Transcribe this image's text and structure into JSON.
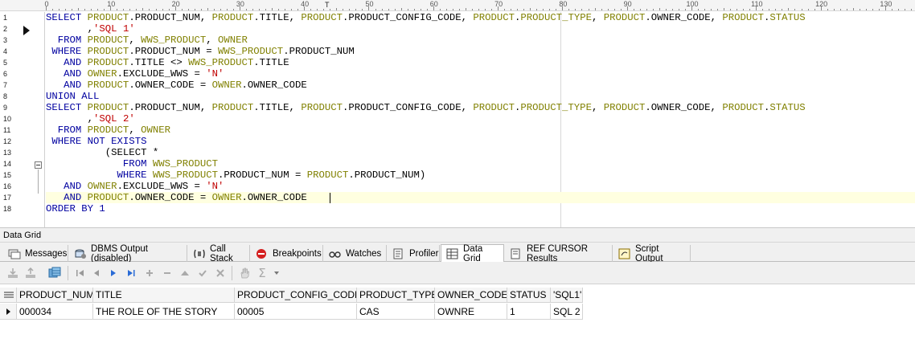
{
  "editor": {
    "ruler_labels": [
      "0",
      "10",
      "20",
      "30",
      "40",
      "50",
      "60",
      "70",
      "80",
      "90",
      "100",
      "110",
      "120",
      "130"
    ],
    "line_numbers": [
      "1",
      "2",
      "3",
      "4",
      "5",
      "6",
      "7",
      "8",
      "9",
      "10",
      "11",
      "12",
      "13",
      "14",
      "15",
      "16",
      "17",
      "18"
    ],
    "lines": [
      [
        [
          "kw",
          "SELECT "
        ],
        [
          "ob",
          "PRODUCT"
        ],
        [
          "sym",
          "."
        ],
        [
          "sym",
          "PRODUCT_NUM"
        ],
        [
          "sym",
          ", "
        ],
        [
          "ob",
          "PRODUCT"
        ],
        [
          "sym",
          ".TITLE, "
        ],
        [
          "ob",
          "PRODUCT"
        ],
        [
          "sym",
          ".PRODUCT_CONFIG_CODE, "
        ],
        [
          "ob",
          "PRODUCT"
        ],
        [
          "sym",
          "."
        ],
        [
          "ob",
          "PRODUCT_TYPE"
        ],
        [
          "sym",
          ", "
        ],
        [
          "ob",
          "PRODUCT"
        ],
        [
          "sym",
          ".OWNER_CODE, "
        ],
        [
          "ob",
          "PRODUCT"
        ],
        [
          "sym",
          "."
        ],
        [
          "ob",
          "STATUS"
        ]
      ],
      [
        [
          "sym",
          "       ,"
        ],
        [
          "str",
          "'SQL 1'"
        ]
      ],
      [
        [
          "kw",
          "  FROM "
        ],
        [
          "ob",
          "PRODUCT"
        ],
        [
          "sym",
          ", "
        ],
        [
          "ob",
          "WWS_PRODUCT"
        ],
        [
          "sym",
          ", "
        ],
        [
          "ob",
          "OWNER"
        ]
      ],
      [
        [
          "kw",
          " WHERE "
        ],
        [
          "ob",
          "PRODUCT"
        ],
        [
          "sym",
          ".PRODUCT_NUM = "
        ],
        [
          "ob",
          "WWS_PRODUCT"
        ],
        [
          "sym",
          ".PRODUCT_NUM"
        ]
      ],
      [
        [
          "kw",
          "   AND "
        ],
        [
          "ob",
          "PRODUCT"
        ],
        [
          "sym",
          ".TITLE <> "
        ],
        [
          "ob",
          "WWS_PRODUCT"
        ],
        [
          "sym",
          ".TITLE"
        ]
      ],
      [
        [
          "kw",
          "   AND "
        ],
        [
          "ob",
          "OWNER"
        ],
        [
          "sym",
          ".EXCLUDE_WWS = "
        ],
        [
          "str",
          "'N'"
        ]
      ],
      [
        [
          "kw",
          "   AND "
        ],
        [
          "ob",
          "PRODUCT"
        ],
        [
          "sym",
          ".OWNER_CODE = "
        ],
        [
          "ob",
          "OWNER"
        ],
        [
          "sym",
          ".OWNER_CODE"
        ]
      ],
      [
        [
          "kw",
          "UNION ALL"
        ]
      ],
      [
        [
          "kw",
          "SELECT "
        ],
        [
          "ob",
          "PRODUCT"
        ],
        [
          "sym",
          ".PRODUCT_NUM, "
        ],
        [
          "ob",
          "PRODUCT"
        ],
        [
          "sym",
          ".TITLE, "
        ],
        [
          "ob",
          "PRODUCT"
        ],
        [
          "sym",
          ".PRODUCT_CONFIG_CODE, "
        ],
        [
          "ob",
          "PRODUCT"
        ],
        [
          "sym",
          "."
        ],
        [
          "ob",
          "PRODUCT_TYPE"
        ],
        [
          "sym",
          ", "
        ],
        [
          "ob",
          "PRODUCT"
        ],
        [
          "sym",
          ".OWNER_CODE, "
        ],
        [
          "ob",
          "PRODUCT"
        ],
        [
          "sym",
          "."
        ],
        [
          "ob",
          "STATUS"
        ]
      ],
      [
        [
          "sym",
          "       ,"
        ],
        [
          "str",
          "'SQL 2'"
        ]
      ],
      [
        [
          "kw",
          "  FROM "
        ],
        [
          "ob",
          "PRODUCT"
        ],
        [
          "sym",
          ", "
        ],
        [
          "ob",
          "OWNER"
        ]
      ],
      [
        [
          "kw",
          " WHERE NOT EXISTS"
        ]
      ],
      [
        [
          "sym",
          "          (SELECT *"
        ]
      ],
      [
        [
          "kw",
          "             FROM "
        ],
        [
          "ob",
          "WWS_PRODUCT"
        ]
      ],
      [
        [
          "kw",
          "            WHERE "
        ],
        [
          "ob",
          "WWS_PRODUCT"
        ],
        [
          "sym",
          ".PRODUCT_NUM = "
        ],
        [
          "ob",
          "PRODUCT"
        ],
        [
          "sym",
          ".PRODUCT_NUM)"
        ]
      ],
      [
        [
          "kw",
          "   AND "
        ],
        [
          "ob",
          "OWNER"
        ],
        [
          "sym",
          ".EXCLUDE_WWS = "
        ],
        [
          "str",
          "'N'"
        ]
      ],
      [
        [
          "kw",
          "   AND "
        ],
        [
          "ob",
          "PRODUCT"
        ],
        [
          "sym",
          ".OWNER_CODE = "
        ],
        [
          "ob",
          "OWNER"
        ],
        [
          "sym",
          ".OWNER_CODE"
        ]
      ],
      [
        [
          "kw",
          "ORDER BY "
        ],
        [
          "num",
          "1"
        ]
      ]
    ]
  },
  "panel": {
    "caption": "Data Grid",
    "tabs": [
      {
        "label": "Messages",
        "icon": "messages-icon"
      },
      {
        "label": "DBMS Output (disabled)",
        "icon": "dbms-output-icon"
      },
      {
        "label": "Call Stack",
        "icon": "call-stack-icon"
      },
      {
        "label": "Breakpoints",
        "icon": "breakpoints-icon"
      },
      {
        "label": "Watches",
        "icon": "watches-icon"
      },
      {
        "label": "Profiler",
        "icon": "profiler-icon"
      },
      {
        "label": "Data Grid",
        "icon": "data-grid-icon"
      },
      {
        "label": "REF CURSOR Results",
        "icon": "ref-cursor-icon"
      },
      {
        "label": "Script Output",
        "icon": "script-output-icon"
      }
    ],
    "active_tab": "Data Grid"
  },
  "grid": {
    "columns": [
      "PRODUCT_NUM",
      "TITLE",
      "PRODUCT_CONFIG_CODE",
      "PRODUCT_TYPE",
      "OWNER_CODE",
      "STATUS",
      "'SQL1'"
    ],
    "rows": [
      [
        "000034",
        "THE ROLE OF THE STORY",
        "00005",
        "CAS",
        "OWNRE",
        "1",
        "SQL 2"
      ]
    ]
  },
  "colors": {
    "keyword": "#0000a0",
    "object": "#808000",
    "string": "#c00000",
    "current_line": "#ffffe0"
  }
}
